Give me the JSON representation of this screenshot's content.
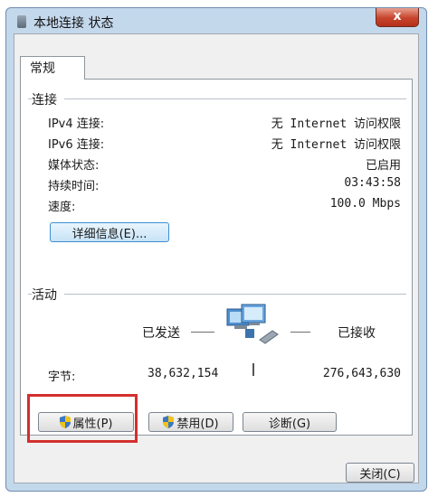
{
  "window": {
    "title": "本地连接 状态",
    "close_label": "x"
  },
  "tabs": [
    {
      "label": "常规"
    }
  ],
  "connection": {
    "group_title": "连接",
    "rows": [
      {
        "label": "IPv4 连接:",
        "value": "无 Internet 访问权限"
      },
      {
        "label": "IPv6 连接:",
        "value": "无 Internet 访问权限"
      },
      {
        "label": "媒体状态:",
        "value": "已启用"
      },
      {
        "label": "持续时间:",
        "value": "03:43:58"
      },
      {
        "label": "速度:",
        "value": "100.0 Mbps"
      }
    ],
    "details_button": "详细信息(E)..."
  },
  "activity": {
    "group_title": "活动",
    "sent_label": "已发送",
    "received_label": "已接收",
    "bytes_label": "字节:",
    "bytes_sent": "38,632,154",
    "bytes_received": "276,643,630"
  },
  "buttons": {
    "properties": "属性(P)",
    "disable": "禁用(D)",
    "diagnose": "诊断(G)",
    "close": "关闭(C)"
  },
  "colors": {
    "highlight_box": "#d32f2f",
    "window_frame": "#c4d8ec"
  }
}
